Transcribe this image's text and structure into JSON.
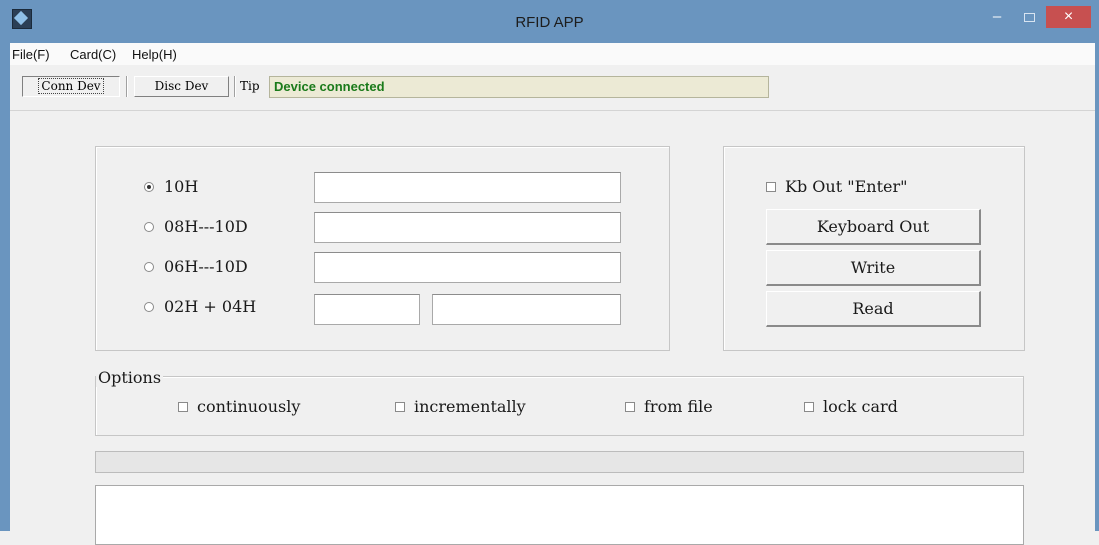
{
  "window": {
    "title": "RFID APP",
    "minimize_glyph": "–",
    "close_glyph": "×",
    "title_bar_color": "#6a95bf",
    "close_color": "#c75050"
  },
  "menu": {
    "items": [
      {
        "label": "File(F)"
      },
      {
        "label": "Card(C)"
      },
      {
        "label": "Help(H)"
      }
    ]
  },
  "toolbar": {
    "conn_label": "Conn Dev",
    "disc_label": "Disc Dev",
    "tip_label": "Tip",
    "status_text": "Device connected",
    "status_color": "#1a7a1a"
  },
  "formats": {
    "options": [
      {
        "label": "10H",
        "selected": true
      },
      {
        "label": "08H---10D",
        "selected": false
      },
      {
        "label": "06H---10D",
        "selected": false
      },
      {
        "label": "02H + 04H",
        "selected": false
      }
    ],
    "values": {
      "hex10": "",
      "hex08_dec10": "",
      "hex06_dec10": "",
      "hex02": "",
      "hex04": ""
    }
  },
  "actions": {
    "kb_enter_label": "Kb Out \"Enter\"",
    "kb_enter_checked": false,
    "keyboard_out_label": "Keyboard Out",
    "write_label": "Write",
    "read_label": "Read"
  },
  "options": {
    "legend": "Options",
    "checks": [
      {
        "label": "continuously",
        "checked": false
      },
      {
        "label": "incrementally",
        "checked": false
      },
      {
        "label": "from file",
        "checked": false
      },
      {
        "label": "lock card",
        "checked": false
      }
    ]
  },
  "progress": {
    "value": 0
  },
  "log": {
    "text": ""
  }
}
